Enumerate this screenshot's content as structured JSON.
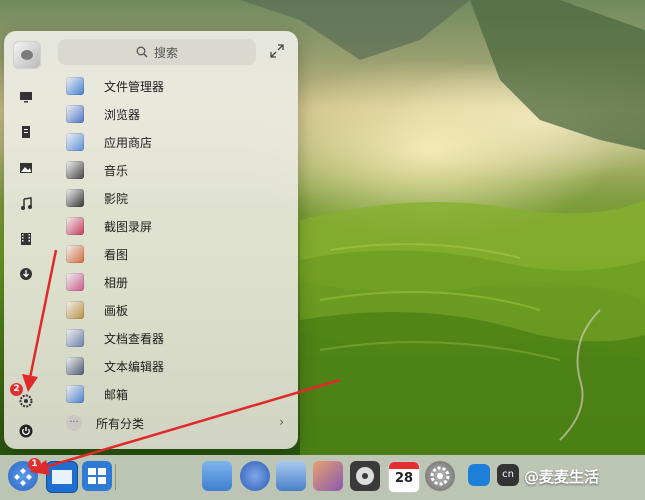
{
  "launcher": {
    "search_placeholder": "搜索",
    "apps": [
      {
        "label": "文件管理器",
        "icon": "folder-icon",
        "color": "#3f7fd0"
      },
      {
        "label": "浏览器",
        "icon": "globe-icon",
        "color": "#4f74c8"
      },
      {
        "label": "应用商店",
        "icon": "store-icon",
        "color": "#5a8fd6"
      },
      {
        "label": "音乐",
        "icon": "music-icon",
        "color": "#444444"
      },
      {
        "label": "影院",
        "icon": "film-icon",
        "color": "#333333"
      },
      {
        "label": "截图录屏",
        "icon": "screenshot-icon",
        "color": "#c63a5a"
      },
      {
        "label": "看图",
        "icon": "image-viewer-icon",
        "color": "#d06a3a"
      },
      {
        "label": "相册",
        "icon": "album-icon",
        "color": "#c85a8a"
      },
      {
        "label": "画板",
        "icon": "palette-icon",
        "color": "#b89040"
      },
      {
        "label": "文档查看器",
        "icon": "document-viewer-icon",
        "color": "#6a7fa8"
      },
      {
        "label": "文本编辑器",
        "icon": "text-editor-icon",
        "color": "#4a5a70"
      },
      {
        "label": "邮箱",
        "icon": "mail-icon",
        "color": "#4a80c8"
      }
    ],
    "all_categories": "所有分类"
  },
  "annotations": {
    "badge_1": "1",
    "badge_2": "2",
    "arrow_color": "#e02a2a"
  },
  "taskbar": {
    "calendar_day": "28",
    "tray_cn": "cn"
  },
  "watermark": "@麦麦生活"
}
